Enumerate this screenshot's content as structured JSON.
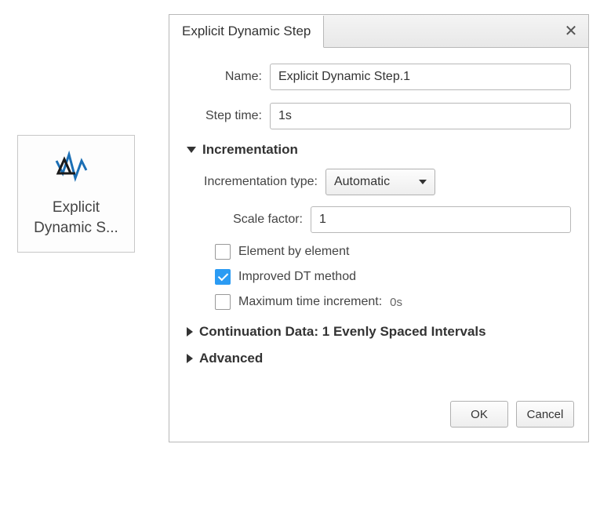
{
  "tool_button": {
    "line1": "Explicit",
    "line2": "Dynamic S..."
  },
  "dialog": {
    "tab_title": "Explicit Dynamic Step",
    "close_glyph": "✕",
    "name": {
      "label": "Name:",
      "value": "Explicit Dynamic Step.1"
    },
    "step_time": {
      "label": "Step time:",
      "value": "1s"
    },
    "incrementation": {
      "header": "Incrementation",
      "type_label": "Incrementation type:",
      "type_value": "Automatic",
      "scale_factor": {
        "label": "Scale factor:",
        "value": "1"
      },
      "element_by_element": {
        "label": "Element by element",
        "checked": false
      },
      "improved_dt": {
        "label": "Improved DT method",
        "checked": true
      },
      "max_time_increment": {
        "label": "Maximum time increment:",
        "checked": false,
        "value": "0s"
      }
    },
    "continuation_header": "Continuation Data:  1 Evenly Spaced Intervals",
    "advanced_header": "Advanced",
    "buttons": {
      "ok": "OK",
      "cancel": "Cancel"
    }
  }
}
